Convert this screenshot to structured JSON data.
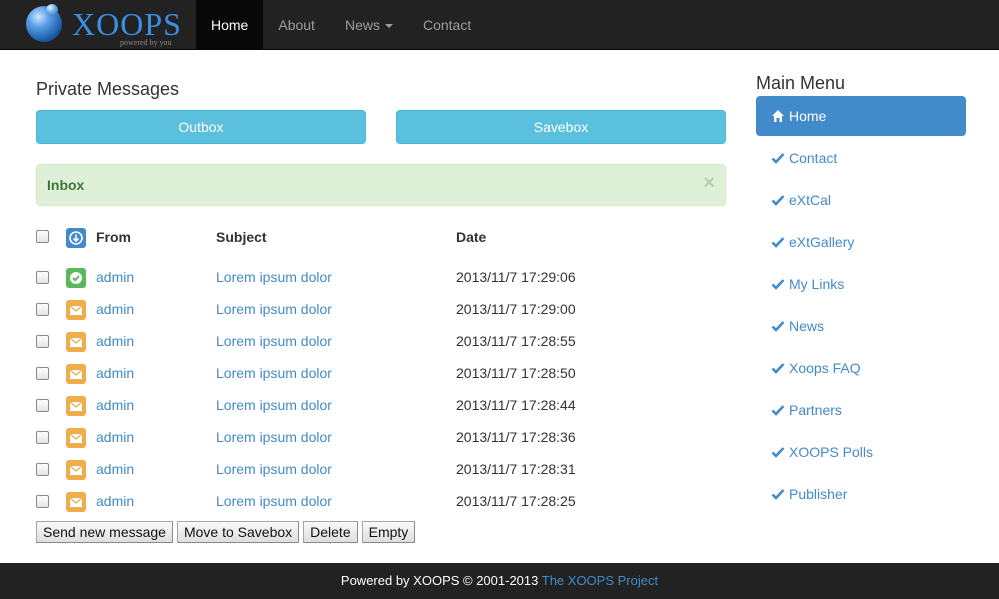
{
  "brand": {
    "name": "XOOPS",
    "tagline": "powered by you"
  },
  "nav": {
    "items": [
      {
        "label": "Home",
        "active": true
      },
      {
        "label": "About"
      },
      {
        "label": "News",
        "dropdown": true
      },
      {
        "label": "Contact"
      }
    ]
  },
  "main": {
    "title": "Private Messages",
    "outbox_label": "Outbox",
    "savebox_label": "Savebox",
    "inbox_label": "Inbox",
    "close_glyph": "×",
    "columns": {
      "from": "From",
      "subject": "Subject",
      "date": "Date"
    },
    "rows": [
      {
        "icon": "read-check-icon",
        "from": "admin",
        "subject": "Lorem ipsum dolor",
        "date": "2013/11/7 17:29:06"
      },
      {
        "icon": "envelope-icon",
        "from": "admin",
        "subject": "Lorem ipsum dolor",
        "date": "2013/11/7 17:29:00"
      },
      {
        "icon": "envelope-icon",
        "from": "admin",
        "subject": "Lorem ipsum dolor",
        "date": "2013/11/7 17:28:55"
      },
      {
        "icon": "envelope-icon",
        "from": "admin",
        "subject": "Lorem ipsum dolor",
        "date": "2013/11/7 17:28:50"
      },
      {
        "icon": "envelope-icon",
        "from": "admin",
        "subject": "Lorem ipsum dolor",
        "date": "2013/11/7 17:28:44"
      },
      {
        "icon": "envelope-icon",
        "from": "admin",
        "subject": "Lorem ipsum dolor",
        "date": "2013/11/7 17:28:36"
      },
      {
        "icon": "envelope-icon",
        "from": "admin",
        "subject": "Lorem ipsum dolor",
        "date": "2013/11/7 17:28:31"
      },
      {
        "icon": "envelope-icon",
        "from": "admin",
        "subject": "Lorem ipsum dolor",
        "date": "2013/11/7 17:28:25"
      }
    ],
    "actions": {
      "send": "Send new message",
      "move": "Move to Savebox",
      "delete": "Delete",
      "empty": "Empty"
    }
  },
  "sidebar": {
    "title": "Main Menu",
    "items": [
      {
        "label": "Home",
        "icon": "home-icon",
        "active": true
      },
      {
        "label": "Contact",
        "icon": "check-icon"
      },
      {
        "label": "eXtCal",
        "icon": "check-icon"
      },
      {
        "label": "eXtGallery",
        "icon": "check-icon"
      },
      {
        "label": "My Links",
        "icon": "check-icon"
      },
      {
        "label": "News",
        "icon": "check-icon"
      },
      {
        "label": "Xoops FAQ",
        "icon": "check-icon"
      },
      {
        "label": "Partners",
        "icon": "check-icon"
      },
      {
        "label": "XOOPS Polls",
        "icon": "check-icon"
      },
      {
        "label": "Publisher",
        "icon": "check-icon"
      }
    ]
  },
  "footer": {
    "text": "Powered by XOOPS © 2001-2013 ",
    "link": "The XOOPS Project"
  },
  "colors": {
    "navbar": "#222222",
    "info": "#5bc0de",
    "success_bg": "#dff0d8",
    "primary": "#428bca",
    "unread_icon": "#f0ad4e",
    "read_icon": "#5cb85c"
  }
}
